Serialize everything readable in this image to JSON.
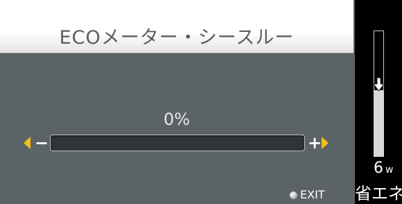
{
  "dialog": {
    "title": "ECOメーター・シースルー",
    "slider_value_text": "0%",
    "slider_level": 0,
    "minus_label": "−",
    "plus_label": "+",
    "exit_label": "EXIT"
  },
  "side_meter": {
    "watt_value": "6",
    "watt_unit": "w",
    "label": "省エネ",
    "fill_fraction": 0.53
  },
  "colors": {
    "panel_bg": "#5b6366",
    "accent_arrows": "#f3be17",
    "track_bg": "#2f3536",
    "title_text": "#5d5d5d"
  },
  "icons": {
    "left_arrow": "yellow-triangle-left",
    "right_arrow": "yellow-triangle-right",
    "exit": "grey-round-button",
    "meter_marker": "down-arrow"
  }
}
